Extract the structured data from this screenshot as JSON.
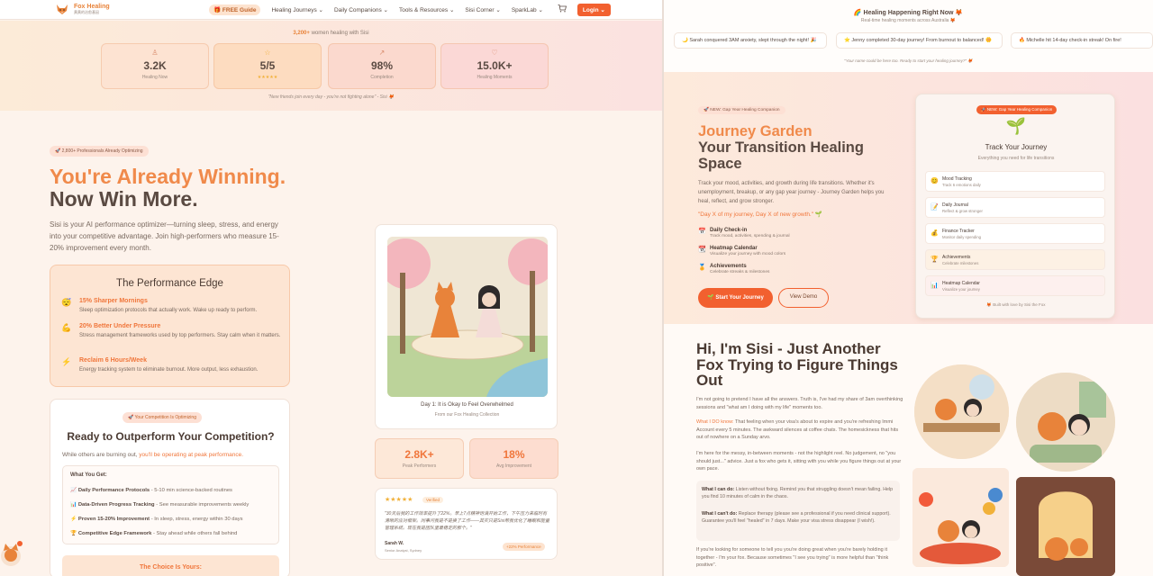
{
  "nav": {
    "logo_title": "Fox Healing",
    "logo_sub": "黄黄的治愈基因",
    "free_guide": "🎁 FREE Guide",
    "links": [
      "Healing Journeys ⌄",
      "Daily Companions ⌄",
      "Tools & Resources ⌄",
      "Sisi Corner ⌄",
      "SparkLab ⌄"
    ],
    "login": "Login ⌄"
  },
  "stats": {
    "line_count": "3,200+",
    "line_rest": " women healing with Sisi",
    "cards": [
      {
        "icon": "♙",
        "value": "3.2K",
        "label": "Healing Now"
      },
      {
        "icon": "☆",
        "value": "5/5",
        "label": "★★★★★"
      },
      {
        "icon": "↗",
        "value": "98%",
        "label": "Completion"
      },
      {
        "icon": "♡",
        "value": "15.0K+",
        "label": "Healing Moments"
      }
    ],
    "friends": "\"New friends join every day - you're not fighting alone\" - Sisi 🦊"
  },
  "hero": {
    "badge": "🚀 2,800+ Professionals Already Optimizing",
    "line1": "You're Already Winning.",
    "line2": "Now Win More.",
    "para": "Sisi is your AI performance optimizer—turning sleep, stress, and energy into your competitive advantage. Join high-performers who measure 15-20% improvement every month."
  },
  "perf": {
    "title": "The Performance Edge",
    "items": [
      {
        "icon": "😴",
        "title": "15% Sharper Mornings",
        "desc": "Sleep optimization protocols that actually work. Wake up ready to perform."
      },
      {
        "icon": "💪",
        "title": "20% Better Under Pressure",
        "desc": "Stress management frameworks used by top performers. Stay calm when it matters."
      },
      {
        "icon": "⚡",
        "title": "Reclaim 6 Hours/Week",
        "desc": "Energy tracking system to eliminate burnout. More output, less exhaustion."
      }
    ]
  },
  "outperf": {
    "badge": "🚀 Your Competition Is Optimizing",
    "title": "Ready to Outperform Your Competition?",
    "while_a": "While others are burning out, ",
    "while_b": "you'll be operating at peak performance.",
    "yget_title": "What You Get:",
    "rows": [
      {
        "icon": "📈",
        "b": "Daily Performance Protocols",
        "t": " - 5-10 min science-backed routines"
      },
      {
        "icon": "📊",
        "b": "Data-Driven Progress Tracking",
        "t": " - See measurable improvements weekly"
      },
      {
        "icon": "⚡",
        "b": "Proven 15-20% Improvement",
        "t": " - In sleep, stress, energy within 30 days"
      },
      {
        "icon": "🏆",
        "b": "Competitive Edge Framework",
        "t": " - Stay ahead while others fall behind"
      }
    ],
    "choice": "The Choice Is Yours:"
  },
  "art": {
    "title": "Day 1: It is Okay to Feel Overwhelmed",
    "sub": "From our Fox Healing Collection"
  },
  "mini": [
    {
      "value": "2.8K+",
      "label": "Peak Performers"
    },
    {
      "value": "18%",
      "label": "Avg Improvement"
    }
  ],
  "testimonial": {
    "stars": "★★★★★",
    "verified": "Verified",
    "quote": "\"30天后我的工作效率提升了22%。早上7点精神饱满开始工作，下午压力来临时有清晰的应对框架。同事问我是不是换了工作——其实只是Sisi帮我优化了睡眠和能量管理系统。现在我是团队里最稳定的那个。\"",
    "name": "Sarah W.",
    "role": "Senior Analyst, Sydney",
    "pill": "+22% Performance"
  },
  "right": {
    "head": "🌈 Healing Happening Right Now 🦊",
    "sub": "Real-time healing moments across Australia 🦊",
    "ticker": [
      "🌙 Sarah conquered 3AM anxiety, slept through the night! 🎉",
      "⭐ Jenny completed 30-day journey! From burnout to balanced! 🌼",
      "🔥 Michelle hit 14-day check-in streak! On fire!"
    ],
    "name_line": "\"Your name could be here too. Ready to start your healing journey?\" 🦊",
    "new_badge": "🚀 NEW: Gap Year Healing Companion",
    "jg": "Journey Garden",
    "jg2": "Your Transition Healing Space",
    "jgp": "Track your mood, activities, and growth during life transitions. Whether it's unemployment, breakup, or any gap year journey - Journey Garden helps you heal, reflect, and grow stronger.",
    "jgq": "\"Day X of my journey, Day X of new growth.\" 🌱",
    "features": [
      {
        "icon": "📅",
        "title": "Daily Check-in",
        "desc": "Track mood, activities, spending & journal"
      },
      {
        "icon": "📆",
        "title": "Heatmap Calendar",
        "desc": "Visualize your journey with mood colors"
      },
      {
        "icon": "🏅",
        "title": "Achievements",
        "desc": "Celebrate streaks & milestones"
      }
    ],
    "start": "🌱 Start Your Journey",
    "demo": "View Demo",
    "track": {
      "badge": "🚀 NEW: Gap Year Healing Companion",
      "sprout": "🌱",
      "title": "Track Your Journey",
      "sub": "Everything you need for life transitions",
      "rows": [
        {
          "icon": "😊",
          "name": "Mood Tracking",
          "desc": "Track 6 emotions daily"
        },
        {
          "icon": "📝",
          "name": "Daily Journal",
          "desc": "Reflect & grow stronger"
        },
        {
          "icon": "💰",
          "name": "Finance Tracker",
          "desc": "Monitor daily spending"
        },
        {
          "icon": "🏆",
          "name": "Achievements",
          "desc": "Celebrate milestones"
        },
        {
          "icon": "📊",
          "name": "Heatmap Calendar",
          "desc": "Visualize your journey"
        }
      ],
      "built": "🦊 Built with love by Sisi the Fox"
    },
    "sisi_title": "Hi, I'm Sisi - Just Another Fox Trying to Figure Things Out",
    "sisi_p1": "I'm not going to pretend I have all the answers. Truth is, I've had my share of 3am overthinking sessions and \"what am I doing with my life\" moments too.",
    "sisi_p2a": "What I DO know:",
    "sisi_p2b": " That feeling when your visa's about to expire and you're refreshing Immi Account every 5 minutes. The awkward silences at coffee chats. The homesickness that hits out of nowhere on a Sunday arvo.",
    "sisi_p3": "I'm here for the messy, in-between moments - not the highlight reel. No judgement, no \"you should just...\" advice. Just a fox who gets it, sitting with you while you figure things out at your own pace.",
    "can_b": "What I can do:",
    "can_t": " Listen without fixing. Remind you that struggling doesn't mean failing. Help you find 10 minutes of calm in the chaos.",
    "cant_b": "What I can't do:",
    "cant_t": " Replace therapy (please see a professional if you need clinical support). Guarantee you'll feel \"healed\" in 7 days. Make your visa stress disappear (I wish!).",
    "sisi_p4": "If you're looking for someone to tell you you're doing great when you're barely holding it together - I'm your fox. Because sometimes \"I see you trying\" is more helpful than \"think positive\"."
  },
  "colors": {
    "accent": "#f2602f",
    "orange_text": "#f08a4b",
    "dark_text": "#4a3a32"
  }
}
